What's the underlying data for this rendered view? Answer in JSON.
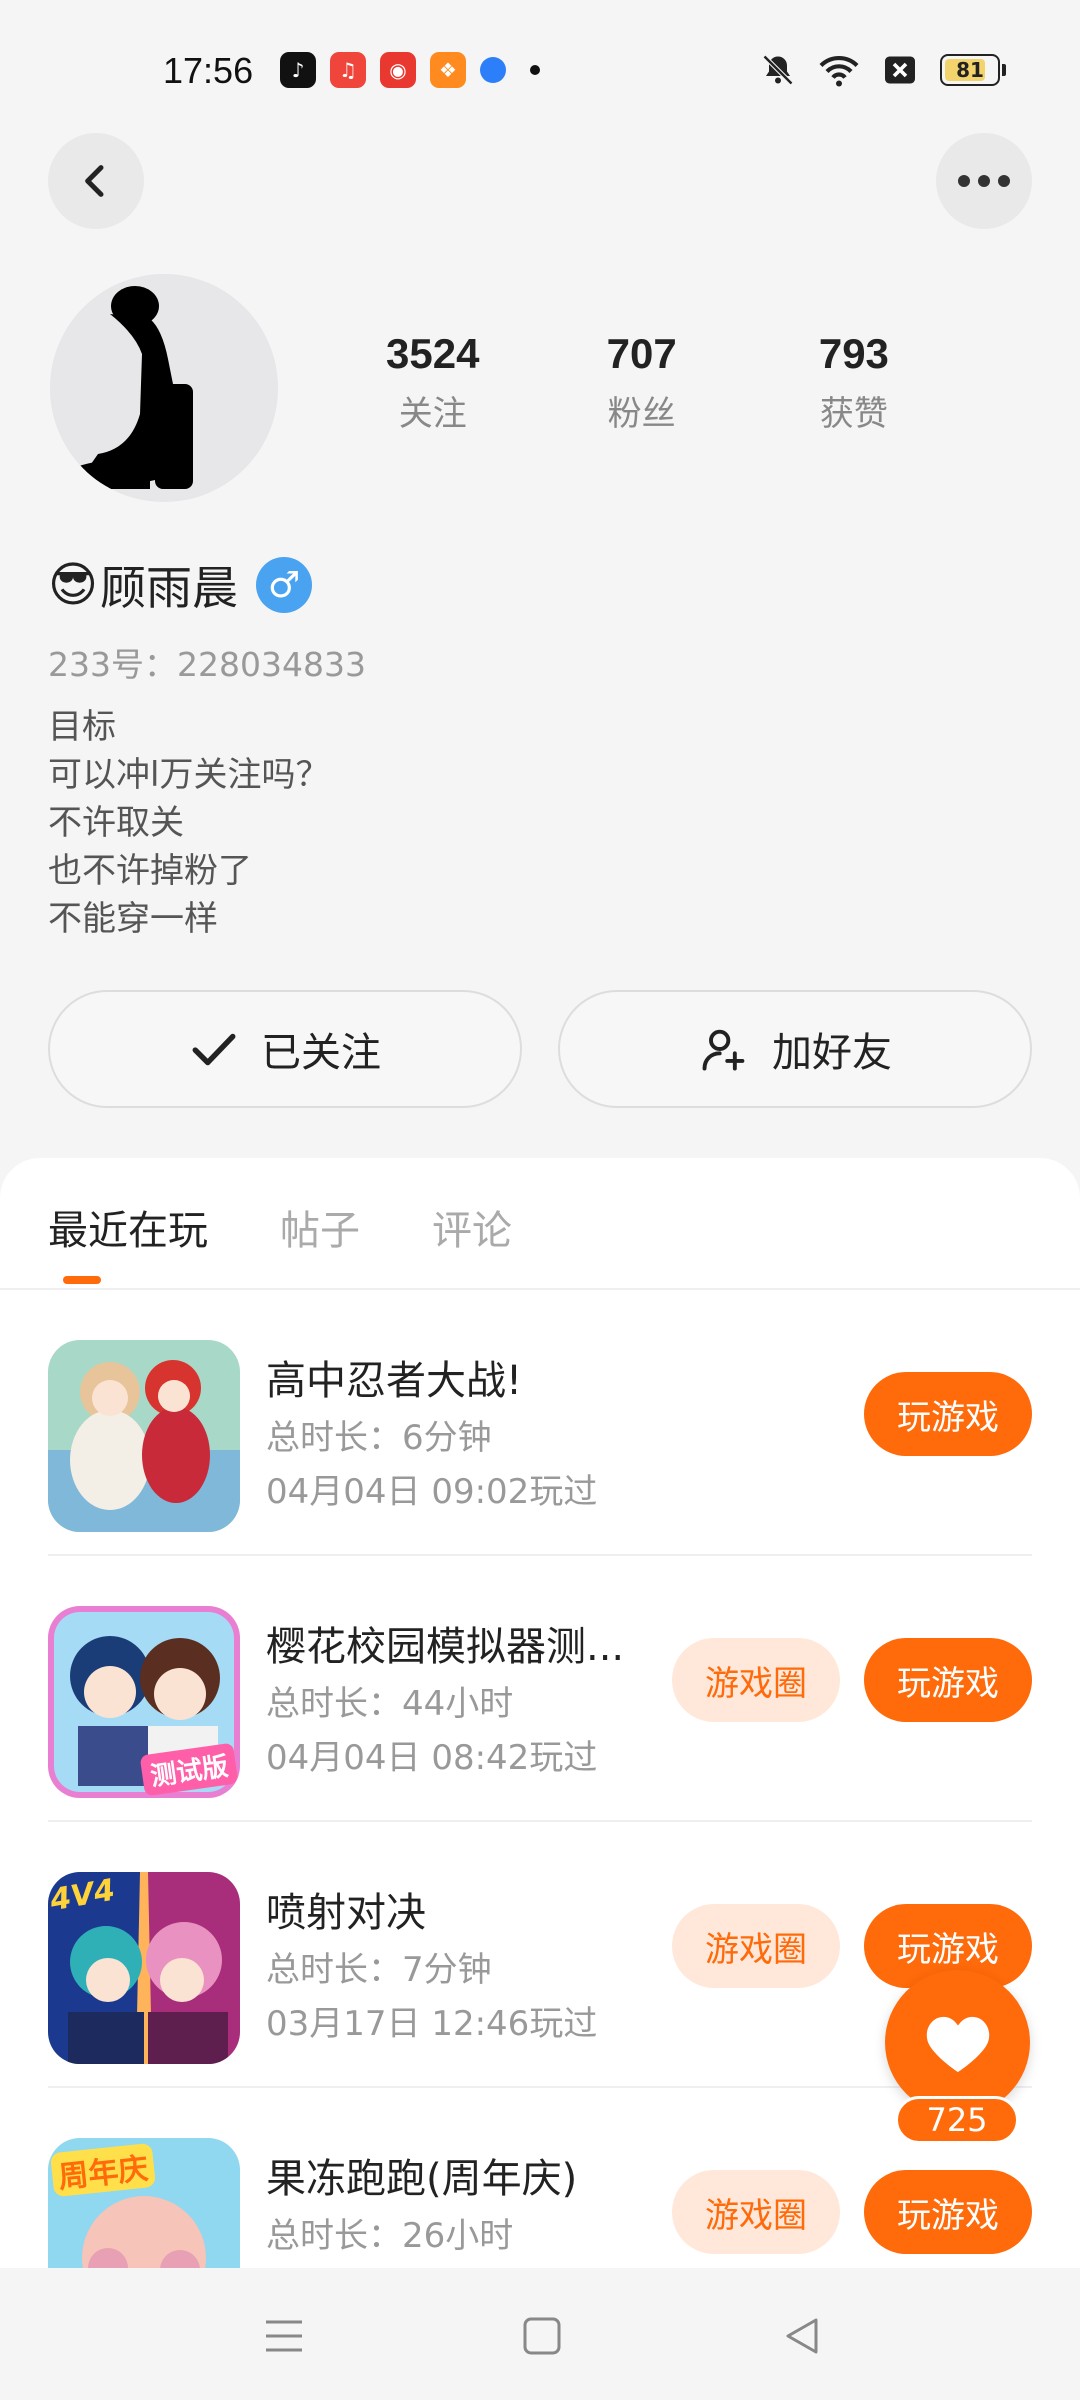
{
  "status_bar": {
    "time": "17:56",
    "battery": "81",
    "battery_level": 0.81,
    "apps": [
      "tiktok-icon",
      "music-icon",
      "red-app-icon",
      "orange-app-icon",
      "blue-app-icon"
    ]
  },
  "profile": {
    "stats": [
      {
        "num": "3524",
        "label": "关注"
      },
      {
        "num": "707",
        "label": "粉丝"
      },
      {
        "num": "793",
        "label": "获赞"
      }
    ],
    "emoji": "😎",
    "name": "顾雨晨",
    "gender": "♂",
    "uid": "233号：228034833",
    "bio": [
      "目标",
      "可以冲l万关注吗？",
      "不许取关",
      "也不许掉粉了",
      "不能穿一样"
    ]
  },
  "actions": {
    "follow_label": "已关注",
    "friend_label": "加好友"
  },
  "tabs": [
    "最近在玩",
    "帖子",
    "评论"
  ],
  "games": [
    {
      "title": "高中忍者大战!",
      "time": "总时长：6分钟",
      "last": "04月04日 09:02玩过",
      "circle": null,
      "play": "玩游戏"
    },
    {
      "title": "樱花校园模拟器测...",
      "time": "总时长：44小时",
      "last": "04月04日 08:42玩过",
      "circle": "游戏圈",
      "play": "玩游戏",
      "icon_text": "测试版"
    },
    {
      "title": "喷射对决",
      "time": "总时长：7分钟",
      "last": "03月17日 12:46玩过",
      "circle": "游戏圈",
      "play": "玩游戏",
      "icon_text": "4V4"
    },
    {
      "title": "果冻跑跑(周年庆)",
      "time": "总时长：26小时",
      "last": "",
      "circle": "游戏圈",
      "play": "玩游戏",
      "icon_text": "周年庆"
    }
  ],
  "like": {
    "count": "725"
  },
  "colors": {
    "accent": "#ff6a0a",
    "accent_light": "#ffe8da",
    "gender": "#4aa3f0"
  }
}
